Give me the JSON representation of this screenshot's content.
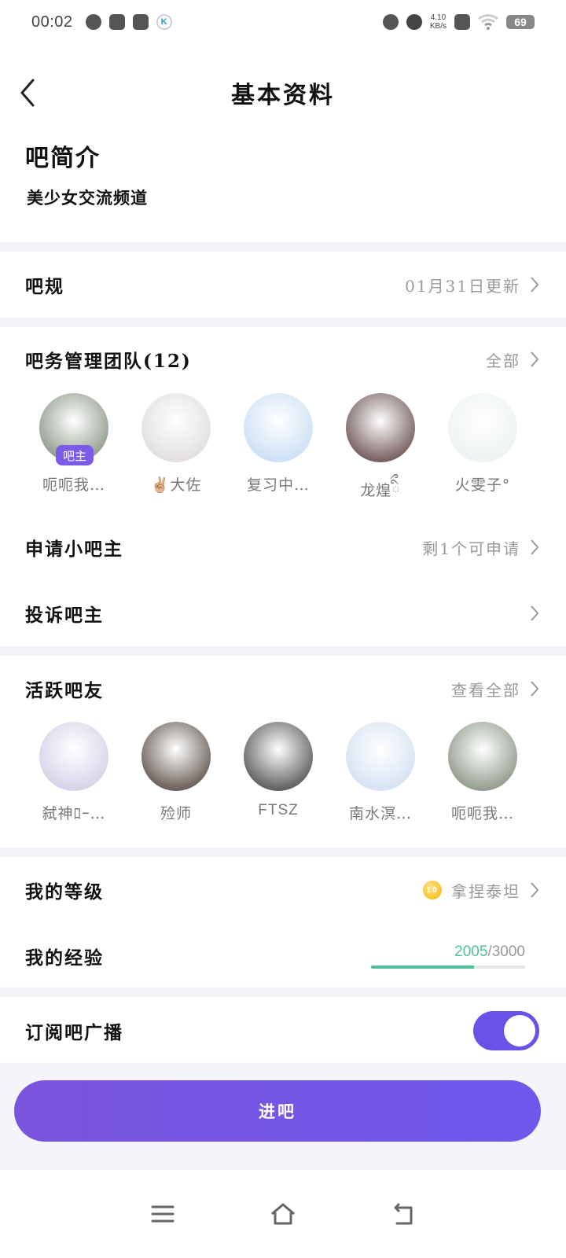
{
  "status_bar": {
    "time": "00:02",
    "network_speed": "4.10",
    "network_unit": "KB/s",
    "battery": "69"
  },
  "header": {
    "title": "基本资料"
  },
  "intro": {
    "title": "吧简介",
    "text": "美少女交流频道"
  },
  "rules": {
    "label": "吧规",
    "value": "01月31日更新"
  },
  "team": {
    "label": "吧务管理团队(12)",
    "action": "全部",
    "members": [
      {
        "name": "呃呃我…",
        "badge": "吧主",
        "color": "#6f7d69"
      },
      {
        "name": "✌🏼大佐",
        "color": "#d9d4d6"
      },
      {
        "name": "复习中…",
        "color": "#bcd6f2"
      },
      {
        "name": "龙煌ིྀ",
        "color": "#4a2a2a"
      },
      {
        "name": "火雯子°",
        "color": "#e8eef0"
      }
    ]
  },
  "apply": {
    "label": "申请小吧主",
    "value": "剩1个可申请"
  },
  "complain": {
    "label": "投诉吧主"
  },
  "active": {
    "label": "活跃吧友",
    "action": "查看全部",
    "members": [
      {
        "name": "弑神ﾛｰ…",
        "color": "#c9c4e3"
      },
      {
        "name": "殓师",
        "color": "#3a2a20"
      },
      {
        "name": "FTSZ",
        "color": "#2e2a2c"
      },
      {
        "name": "南水溟…",
        "color": "#c8d9f0"
      },
      {
        "name": "呃呃我…",
        "color": "#6f7d69"
      }
    ]
  },
  "level": {
    "label": "我的等级",
    "icon_text": "10",
    "value": "拿捏泰坦"
  },
  "exp": {
    "label": "我的经验",
    "current": "2005",
    "total": "/3000",
    "progress": 0.668
  },
  "subscribe": {
    "label": "订阅吧广播",
    "enabled": true
  },
  "enter_button": "进吧",
  "icons": {
    "back": "chevron-left-icon",
    "chevron": "chevron-right-icon",
    "menu": "menu-icon",
    "home": "home-icon",
    "return": "back-arrow-icon"
  },
  "colors": {
    "accent": "#6a52e8",
    "progress": "#4fbf9f",
    "badge": "#7b5ce6"
  }
}
